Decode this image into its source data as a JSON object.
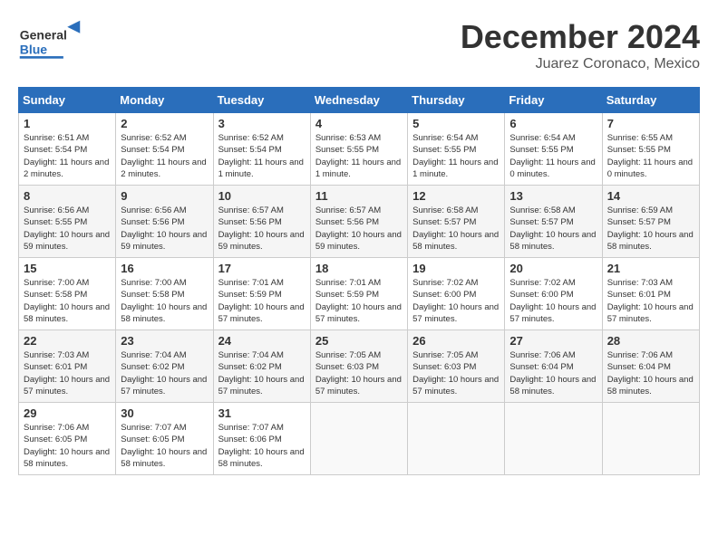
{
  "header": {
    "logo_general": "General",
    "logo_blue": "Blue",
    "main_title": "December 2024",
    "subtitle": "Juarez Coronaco, Mexico"
  },
  "calendar": {
    "days_of_week": [
      "Sunday",
      "Monday",
      "Tuesday",
      "Wednesday",
      "Thursday",
      "Friday",
      "Saturday"
    ],
    "weeks": [
      [
        {
          "day": "1",
          "sunrise": "6:51 AM",
          "sunset": "5:54 PM",
          "daylight": "11 hours and 2 minutes."
        },
        {
          "day": "2",
          "sunrise": "6:52 AM",
          "sunset": "5:54 PM",
          "daylight": "11 hours and 2 minutes."
        },
        {
          "day": "3",
          "sunrise": "6:52 AM",
          "sunset": "5:54 PM",
          "daylight": "11 hours and 1 minute."
        },
        {
          "day": "4",
          "sunrise": "6:53 AM",
          "sunset": "5:55 PM",
          "daylight": "11 hours and 1 minute."
        },
        {
          "day": "5",
          "sunrise": "6:54 AM",
          "sunset": "5:55 PM",
          "daylight": "11 hours and 1 minute."
        },
        {
          "day": "6",
          "sunrise": "6:54 AM",
          "sunset": "5:55 PM",
          "daylight": "11 hours and 0 minutes."
        },
        {
          "day": "7",
          "sunrise": "6:55 AM",
          "sunset": "5:55 PM",
          "daylight": "11 hours and 0 minutes."
        }
      ],
      [
        {
          "day": "8",
          "sunrise": "6:56 AM",
          "sunset": "5:55 PM",
          "daylight": "10 hours and 59 minutes."
        },
        {
          "day": "9",
          "sunrise": "6:56 AM",
          "sunset": "5:56 PM",
          "daylight": "10 hours and 59 minutes."
        },
        {
          "day": "10",
          "sunrise": "6:57 AM",
          "sunset": "5:56 PM",
          "daylight": "10 hours and 59 minutes."
        },
        {
          "day": "11",
          "sunrise": "6:57 AM",
          "sunset": "5:56 PM",
          "daylight": "10 hours and 59 minutes."
        },
        {
          "day": "12",
          "sunrise": "6:58 AM",
          "sunset": "5:57 PM",
          "daylight": "10 hours and 58 minutes."
        },
        {
          "day": "13",
          "sunrise": "6:58 AM",
          "sunset": "5:57 PM",
          "daylight": "10 hours and 58 minutes."
        },
        {
          "day": "14",
          "sunrise": "6:59 AM",
          "sunset": "5:57 PM",
          "daylight": "10 hours and 58 minutes."
        }
      ],
      [
        {
          "day": "15",
          "sunrise": "7:00 AM",
          "sunset": "5:58 PM",
          "daylight": "10 hours and 58 minutes."
        },
        {
          "day": "16",
          "sunrise": "7:00 AM",
          "sunset": "5:58 PM",
          "daylight": "10 hours and 58 minutes."
        },
        {
          "day": "17",
          "sunrise": "7:01 AM",
          "sunset": "5:59 PM",
          "daylight": "10 hours and 57 minutes."
        },
        {
          "day": "18",
          "sunrise": "7:01 AM",
          "sunset": "5:59 PM",
          "daylight": "10 hours and 57 minutes."
        },
        {
          "day": "19",
          "sunrise": "7:02 AM",
          "sunset": "6:00 PM",
          "daylight": "10 hours and 57 minutes."
        },
        {
          "day": "20",
          "sunrise": "7:02 AM",
          "sunset": "6:00 PM",
          "daylight": "10 hours and 57 minutes."
        },
        {
          "day": "21",
          "sunrise": "7:03 AM",
          "sunset": "6:01 PM",
          "daylight": "10 hours and 57 minutes."
        }
      ],
      [
        {
          "day": "22",
          "sunrise": "7:03 AM",
          "sunset": "6:01 PM",
          "daylight": "10 hours and 57 minutes."
        },
        {
          "day": "23",
          "sunrise": "7:04 AM",
          "sunset": "6:02 PM",
          "daylight": "10 hours and 57 minutes."
        },
        {
          "day": "24",
          "sunrise": "7:04 AM",
          "sunset": "6:02 PM",
          "daylight": "10 hours and 57 minutes."
        },
        {
          "day": "25",
          "sunrise": "7:05 AM",
          "sunset": "6:03 PM",
          "daylight": "10 hours and 57 minutes."
        },
        {
          "day": "26",
          "sunrise": "7:05 AM",
          "sunset": "6:03 PM",
          "daylight": "10 hours and 57 minutes."
        },
        {
          "day": "27",
          "sunrise": "7:06 AM",
          "sunset": "6:04 PM",
          "daylight": "10 hours and 58 minutes."
        },
        {
          "day": "28",
          "sunrise": "7:06 AM",
          "sunset": "6:04 PM",
          "daylight": "10 hours and 58 minutes."
        }
      ],
      [
        {
          "day": "29",
          "sunrise": "7:06 AM",
          "sunset": "6:05 PM",
          "daylight": "10 hours and 58 minutes."
        },
        {
          "day": "30",
          "sunrise": "7:07 AM",
          "sunset": "6:05 PM",
          "daylight": "10 hours and 58 minutes."
        },
        {
          "day": "31",
          "sunrise": "7:07 AM",
          "sunset": "6:06 PM",
          "daylight": "10 hours and 58 minutes."
        },
        null,
        null,
        null,
        null
      ]
    ]
  }
}
